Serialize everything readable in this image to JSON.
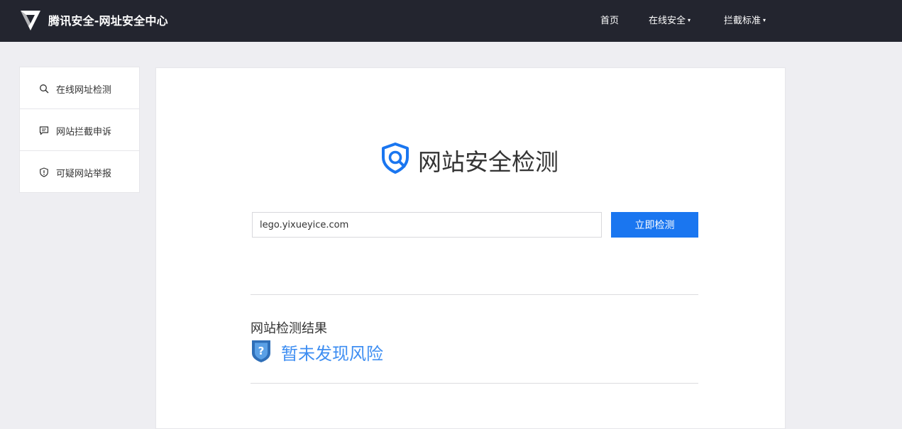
{
  "header": {
    "logo_icon": "tencent-shield-logo",
    "title": "腾讯安全-网址安全中心",
    "nav": [
      {
        "label": "首页",
        "has_dropdown": false
      },
      {
        "label": "在线安全",
        "has_dropdown": true
      },
      {
        "label": "拦截标准",
        "has_dropdown": true
      }
    ],
    "dropdown_glyph": "▾"
  },
  "sidebar": {
    "items": [
      {
        "label": "在线网址检测",
        "icon": "search-icon"
      },
      {
        "label": "网站拦截申诉",
        "icon": "message-icon"
      },
      {
        "label": "可疑网站举报",
        "icon": "shield-alert-icon"
      }
    ]
  },
  "main": {
    "title": "网站安全检测",
    "url_input": {
      "value": "lego.yixueyice.com"
    },
    "check_button": "立即检测",
    "result_heading": "网站检测结果",
    "result_text": "暂未发现风险",
    "result_icon": "question-shield-icon"
  },
  "colors": {
    "header_bg": "#23252f",
    "page_bg": "#eeeef2",
    "accent": "#1a76f0",
    "result": "#3e8ef2"
  }
}
